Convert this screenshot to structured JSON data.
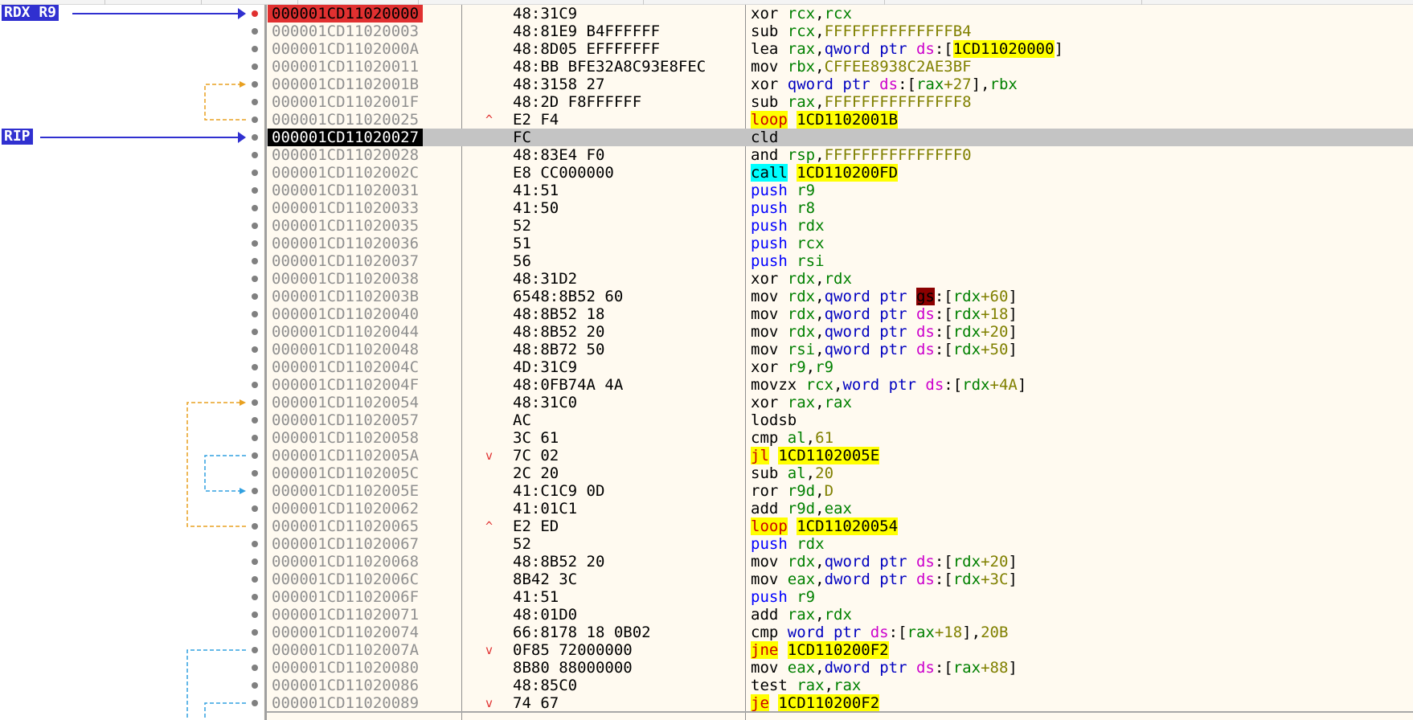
{
  "labels": {
    "rdx_r9": "RDX R9",
    "rip": "RIP"
  },
  "colors": {
    "breakpoint": "#e03030",
    "current": "#000000",
    "label_bg": "#3030d0",
    "jump_yellow": "#ffff00",
    "call_cyan": "#00ffff"
  },
  "rows": [
    {
      "addr": "000001CD11020000",
      "bytes": "48:31C9",
      "mn": "xor",
      "ops": [
        [
          "rcx",
          "reg"
        ],
        [
          ",",
          "punct"
        ],
        [
          "rcx",
          "reg"
        ]
      ]
    },
    {
      "addr": "000001CD11020003",
      "bytes": "48:81E9 B4FFFFFF",
      "mn": "sub",
      "ops": [
        [
          "rcx",
          "reg"
        ],
        [
          ",",
          "punct"
        ],
        [
          "FFFFFFFFFFFFFFB4",
          "imm"
        ]
      ]
    },
    {
      "addr": "000001CD1102000A",
      "bytes": "48:8D05 EFFFFFFF",
      "mn": "lea",
      "ops": [
        [
          "rax",
          "reg"
        ],
        [
          ",",
          "punct"
        ],
        [
          "qword ptr ",
          "kw"
        ],
        [
          "ds",
          "seg"
        ],
        [
          ":[",
          "punct"
        ],
        [
          "1CD11020000",
          "tgt"
        ],
        [
          "]",
          "punct"
        ]
      ]
    },
    {
      "addr": "000001CD11020011",
      "bytes": "48:BB BFE32A8C93E8FEC",
      "mn": "mov",
      "ops": [
        [
          "rbx",
          "reg"
        ],
        [
          ",",
          "punct"
        ],
        [
          "CFFEE8938C2AE3BF",
          "imm"
        ]
      ]
    },
    {
      "addr": "000001CD1102001B",
      "bytes": "48:3158 27",
      "mn": "xor",
      "ops": [
        [
          "qword ptr ",
          "kw"
        ],
        [
          "ds",
          "seg"
        ],
        [
          ":[",
          "punct"
        ],
        [
          "rax",
          "reg"
        ],
        [
          "+27",
          "imm"
        ],
        [
          "],",
          "punct"
        ],
        [
          "rbx",
          "reg"
        ]
      ]
    },
    {
      "addr": "000001CD1102001F",
      "bytes": "48:2D F8FFFFFF",
      "mn": "sub",
      "ops": [
        [
          "rax",
          "reg"
        ],
        [
          ",",
          "punct"
        ],
        [
          "FFFFFFFFFFFFFFF8",
          "imm"
        ]
      ]
    },
    {
      "addr": "000001CD11020025",
      "bytes": "E2 F4",
      "arrow": "^",
      "mn": "loop",
      "mnclass": "loop",
      "ops": [
        [
          "1CD1102001B",
          "tgt"
        ]
      ]
    },
    {
      "addr": "000001CD11020027",
      "bytes": "FC",
      "mn": "cld",
      "ops": [],
      "current": true
    },
    {
      "addr": "000001CD11020028",
      "bytes": "48:83E4 F0",
      "mn": "and",
      "ops": [
        [
          "rsp",
          "reg"
        ],
        [
          ",",
          "punct"
        ],
        [
          "FFFFFFFFFFFFFFF0",
          "imm"
        ]
      ]
    },
    {
      "addr": "000001CD1102002C",
      "bytes": "E8 CC000000",
      "mn": "call",
      "mnclass": "call",
      "ops": [
        [
          "1CD110200FD",
          "tgt"
        ]
      ]
    },
    {
      "addr": "000001CD11020031",
      "bytes": "41:51",
      "mn": "push",
      "mnclass": "push",
      "ops": [
        [
          "r9",
          "reg"
        ]
      ]
    },
    {
      "addr": "000001CD11020033",
      "bytes": "41:50",
      "mn": "push",
      "mnclass": "push",
      "ops": [
        [
          "r8",
          "reg"
        ]
      ]
    },
    {
      "addr": "000001CD11020035",
      "bytes": "52",
      "mn": "push",
      "mnclass": "push",
      "ops": [
        [
          "rdx",
          "reg"
        ]
      ]
    },
    {
      "addr": "000001CD11020036",
      "bytes": "51",
      "mn": "push",
      "mnclass": "push",
      "ops": [
        [
          "rcx",
          "reg"
        ]
      ]
    },
    {
      "addr": "000001CD11020037",
      "bytes": "56",
      "mn": "push",
      "mnclass": "push",
      "ops": [
        [
          "rsi",
          "reg"
        ]
      ]
    },
    {
      "addr": "000001CD11020038",
      "bytes": "48:31D2",
      "mn": "xor",
      "ops": [
        [
          "rdx",
          "reg"
        ],
        [
          ",",
          "punct"
        ],
        [
          "rdx",
          "reg"
        ]
      ]
    },
    {
      "addr": "000001CD1102003B",
      "bytes": "6548:8B52 60",
      "mn": "mov",
      "ops": [
        [
          "rdx",
          "reg"
        ],
        [
          ",",
          "punct"
        ],
        [
          "qword ptr ",
          "kw"
        ],
        [
          "gs",
          "gs"
        ],
        [
          ":[",
          "punct"
        ],
        [
          "rdx",
          "reg"
        ],
        [
          "+60",
          "imm"
        ],
        [
          "]",
          "punct"
        ]
      ]
    },
    {
      "addr": "000001CD11020040",
      "bytes": "48:8B52 18",
      "mn": "mov",
      "ops": [
        [
          "rdx",
          "reg"
        ],
        [
          ",",
          "punct"
        ],
        [
          "qword ptr ",
          "kw"
        ],
        [
          "ds",
          "seg"
        ],
        [
          ":[",
          "punct"
        ],
        [
          "rdx",
          "reg"
        ],
        [
          "+18",
          "imm"
        ],
        [
          "]",
          "punct"
        ]
      ]
    },
    {
      "addr": "000001CD11020044",
      "bytes": "48:8B52 20",
      "mn": "mov",
      "ops": [
        [
          "rdx",
          "reg"
        ],
        [
          ",",
          "punct"
        ],
        [
          "qword ptr ",
          "kw"
        ],
        [
          "ds",
          "seg"
        ],
        [
          ":[",
          "punct"
        ],
        [
          "rdx",
          "reg"
        ],
        [
          "+20",
          "imm"
        ],
        [
          "]",
          "punct"
        ]
      ]
    },
    {
      "addr": "000001CD11020048",
      "bytes": "48:8B72 50",
      "mn": "mov",
      "ops": [
        [
          "rsi",
          "reg"
        ],
        [
          ",",
          "punct"
        ],
        [
          "qword ptr ",
          "kw"
        ],
        [
          "ds",
          "seg"
        ],
        [
          ":[",
          "punct"
        ],
        [
          "rdx",
          "reg"
        ],
        [
          "+50",
          "imm"
        ],
        [
          "]",
          "punct"
        ]
      ]
    },
    {
      "addr": "000001CD1102004C",
      "bytes": "4D:31C9",
      "mn": "xor",
      "ops": [
        [
          "r9",
          "reg"
        ],
        [
          ",",
          "punct"
        ],
        [
          "r9",
          "reg"
        ]
      ]
    },
    {
      "addr": "000001CD1102004F",
      "bytes": "48:0FB74A 4A",
      "mn": "movzx",
      "ops": [
        [
          "rcx",
          "reg"
        ],
        [
          ",",
          "punct"
        ],
        [
          "word ptr ",
          "kw"
        ],
        [
          "ds",
          "seg"
        ],
        [
          ":[",
          "punct"
        ],
        [
          "rdx",
          "reg"
        ],
        [
          "+4A",
          "imm"
        ],
        [
          "]",
          "punct"
        ]
      ]
    },
    {
      "addr": "000001CD11020054",
      "bytes": "48:31C0",
      "mn": "xor",
      "ops": [
        [
          "rax",
          "reg"
        ],
        [
          ",",
          "punct"
        ],
        [
          "rax",
          "reg"
        ]
      ]
    },
    {
      "addr": "000001CD11020057",
      "bytes": "AC",
      "mn": "lodsb",
      "ops": []
    },
    {
      "addr": "000001CD11020058",
      "bytes": "3C 61",
      "mn": "cmp",
      "ops": [
        [
          "al",
          "reg"
        ],
        [
          ",",
          "punct"
        ],
        [
          "61",
          "imm"
        ]
      ]
    },
    {
      "addr": "000001CD1102005A",
      "bytes": "7C 02",
      "arrow": "v",
      "mn": "jl",
      "mnclass": "jmp",
      "ops": [
        [
          "1CD1102005E",
          "tgt"
        ]
      ]
    },
    {
      "addr": "000001CD1102005C",
      "bytes": "2C 20",
      "mn": "sub",
      "ops": [
        [
          "al",
          "reg"
        ],
        [
          ",",
          "punct"
        ],
        [
          "20",
          "imm"
        ]
      ]
    },
    {
      "addr": "000001CD1102005E",
      "bytes": "41:C1C9 0D",
      "mn": "ror",
      "ops": [
        [
          "r9d",
          "reg"
        ],
        [
          ",",
          "punct"
        ],
        [
          "D",
          "imm"
        ]
      ]
    },
    {
      "addr": "000001CD11020062",
      "bytes": "41:01C1",
      "mn": "add",
      "ops": [
        [
          "r9d",
          "reg"
        ],
        [
          ",",
          "punct"
        ],
        [
          "eax",
          "reg"
        ]
      ]
    },
    {
      "addr": "000001CD11020065",
      "bytes": "E2 ED",
      "arrow": "^",
      "mn": "loop",
      "mnclass": "loop",
      "ops": [
        [
          "1CD11020054",
          "tgt"
        ]
      ]
    },
    {
      "addr": "000001CD11020067",
      "bytes": "52",
      "mn": "push",
      "mnclass": "push",
      "ops": [
        [
          "rdx",
          "reg"
        ]
      ]
    },
    {
      "addr": "000001CD11020068",
      "bytes": "48:8B52 20",
      "mn": "mov",
      "ops": [
        [
          "rdx",
          "reg"
        ],
        [
          ",",
          "punct"
        ],
        [
          "qword ptr ",
          "kw"
        ],
        [
          "ds",
          "seg"
        ],
        [
          ":[",
          "punct"
        ],
        [
          "rdx",
          "reg"
        ],
        [
          "+20",
          "imm"
        ],
        [
          "]",
          "punct"
        ]
      ]
    },
    {
      "addr": "000001CD1102006C",
      "bytes": "8B42 3C",
      "mn": "mov",
      "ops": [
        [
          "eax",
          "reg"
        ],
        [
          ",",
          "punct"
        ],
        [
          "dword ptr ",
          "kw"
        ],
        [
          "ds",
          "seg"
        ],
        [
          ":[",
          "punct"
        ],
        [
          "rdx",
          "reg"
        ],
        [
          "+3C",
          "imm"
        ],
        [
          "]",
          "punct"
        ]
      ]
    },
    {
      "addr": "000001CD1102006F",
      "bytes": "41:51",
      "mn": "push",
      "mnclass": "push",
      "ops": [
        [
          "r9",
          "reg"
        ]
      ]
    },
    {
      "addr": "000001CD11020071",
      "bytes": "48:01D0",
      "mn": "add",
      "ops": [
        [
          "rax",
          "reg"
        ],
        [
          ",",
          "punct"
        ],
        [
          "rdx",
          "reg"
        ]
      ]
    },
    {
      "addr": "000001CD11020074",
      "bytes": "66:8178 18 0B02",
      "mn": "cmp",
      "ops": [
        [
          "word ptr ",
          "kw"
        ],
        [
          "ds",
          "seg"
        ],
        [
          ":[",
          "punct"
        ],
        [
          "rax",
          "reg"
        ],
        [
          "+18",
          "imm"
        ],
        [
          "],",
          "punct"
        ],
        [
          "20B",
          "imm"
        ]
      ]
    },
    {
      "addr": "000001CD1102007A",
      "bytes": "0F85 72000000",
      "arrow": "v",
      "mn": "jne",
      "mnclass": "jmp",
      "ops": [
        [
          "1CD110200F2",
          "tgt"
        ]
      ]
    },
    {
      "addr": "000001CD11020080",
      "bytes": "8B80 88000000",
      "mn": "mov",
      "ops": [
        [
          "eax",
          "reg"
        ],
        [
          ",",
          "punct"
        ],
        [
          "dword ptr ",
          "kw"
        ],
        [
          "ds",
          "seg"
        ],
        [
          ":[",
          "punct"
        ],
        [
          "rax",
          "reg"
        ],
        [
          "+88",
          "imm"
        ],
        [
          "]",
          "punct"
        ]
      ]
    },
    {
      "addr": "000001CD11020086",
      "bytes": "48:85C0",
      "mn": "test",
      "ops": [
        [
          "rax",
          "reg"
        ],
        [
          ",",
          "punct"
        ],
        [
          "rax",
          "reg"
        ]
      ]
    },
    {
      "addr": "000001CD11020089",
      "bytes": "74 67",
      "arrow": "v",
      "mn": "je",
      "mnclass": "jmp",
      "ops": [
        [
          "1CD110200F2",
          "tgt"
        ]
      ]
    }
  ]
}
